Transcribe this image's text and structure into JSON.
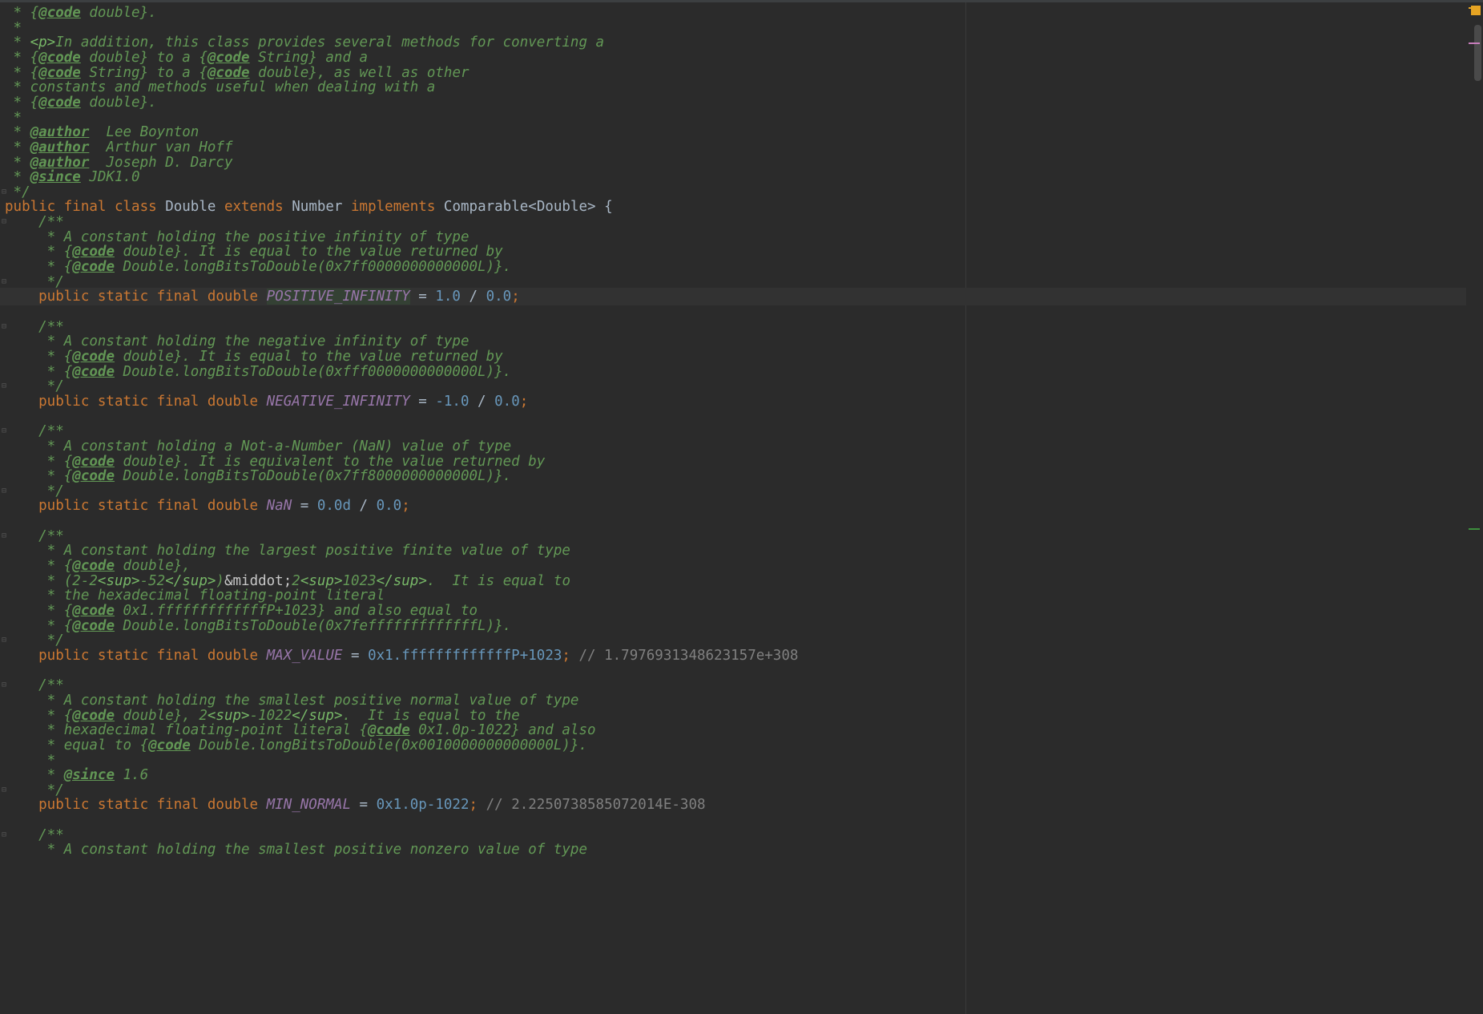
{
  "editor": {
    "language": "java",
    "file_class": "Double",
    "colors": {
      "background": "#2b2b2b",
      "doc_comment": "#629755",
      "keyword": "#cc7832",
      "static_field": "#9876aa",
      "number": "#6897bb",
      "identifier": "#a9b7c6",
      "line_comment": "#808080",
      "caret_line": "#323232"
    },
    "lines": [
      {
        "tokens": [
          {
            "c": "tok-doc",
            "t": " * {"
          },
          {
            "c": "tok-doctag",
            "t": "@code"
          },
          {
            "c": "tok-doc",
            "t": " double}."
          }
        ]
      },
      {
        "tokens": [
          {
            "c": "tok-doc",
            "t": " *"
          }
        ]
      },
      {
        "tokens": [
          {
            "c": "tok-doc",
            "t": " * "
          },
          {
            "c": "tok-dochtml",
            "t": "<p>"
          },
          {
            "c": "tok-doc",
            "t": "In addition, this class provides several methods for converting a"
          }
        ]
      },
      {
        "tokens": [
          {
            "c": "tok-doc",
            "t": " * {"
          },
          {
            "c": "tok-doctag",
            "t": "@code"
          },
          {
            "c": "tok-doc",
            "t": " double} to a {"
          },
          {
            "c": "tok-doctag",
            "t": "@code"
          },
          {
            "c": "tok-doc",
            "t": " String} and a"
          }
        ]
      },
      {
        "tokens": [
          {
            "c": "tok-doc",
            "t": " * {"
          },
          {
            "c": "tok-doctag",
            "t": "@code"
          },
          {
            "c": "tok-doc",
            "t": " String} to a {"
          },
          {
            "c": "tok-doctag",
            "t": "@code"
          },
          {
            "c": "tok-doc",
            "t": " double}, as well as other"
          }
        ]
      },
      {
        "tokens": [
          {
            "c": "tok-doc",
            "t": " * constants and methods useful when dealing with a"
          }
        ]
      },
      {
        "tokens": [
          {
            "c": "tok-doc",
            "t": " * {"
          },
          {
            "c": "tok-doctag",
            "t": "@code"
          },
          {
            "c": "tok-doc",
            "t": " double}."
          }
        ]
      },
      {
        "tokens": [
          {
            "c": "tok-doc",
            "t": " *"
          }
        ]
      },
      {
        "tokens": [
          {
            "c": "tok-doc",
            "t": " * "
          },
          {
            "c": "tok-doctag",
            "t": "@author"
          },
          {
            "c": "tok-doc",
            "t": "  Lee Boynton"
          }
        ]
      },
      {
        "tokens": [
          {
            "c": "tok-doc",
            "t": " * "
          },
          {
            "c": "tok-doctag",
            "t": "@author"
          },
          {
            "c": "tok-doc",
            "t": "  Arthur van Hoff"
          }
        ]
      },
      {
        "tokens": [
          {
            "c": "tok-doc",
            "t": " * "
          },
          {
            "c": "tok-doctag",
            "t": "@author"
          },
          {
            "c": "tok-doc",
            "t": "  Joseph D. Darcy"
          }
        ]
      },
      {
        "tokens": [
          {
            "c": "tok-doc",
            "t": " * "
          },
          {
            "c": "tok-doctag",
            "t": "@since"
          },
          {
            "c": "tok-doc",
            "t": " JDK1.0"
          }
        ]
      },
      {
        "fold": true,
        "tokens": [
          {
            "c": "tok-doc",
            "t": " */"
          }
        ]
      },
      {
        "tokens": [
          {
            "c": "tok-kw",
            "t": "public final class "
          },
          {
            "c": "tok-id",
            "t": "Double "
          },
          {
            "c": "tok-kw",
            "t": "extends "
          },
          {
            "c": "tok-id",
            "t": "Number "
          },
          {
            "c": "tok-kw",
            "t": "implements "
          },
          {
            "c": "tok-id",
            "t": "Comparable<Double> {"
          }
        ]
      },
      {
        "fold": true,
        "tokens": [
          {
            "c": "tok-doc",
            "t": "    /**"
          }
        ]
      },
      {
        "tokens": [
          {
            "c": "tok-doc",
            "t": "     * A constant holding the positive infinity of type"
          }
        ]
      },
      {
        "tokens": [
          {
            "c": "tok-doc",
            "t": "     * {"
          },
          {
            "c": "tok-doctag",
            "t": "@code"
          },
          {
            "c": "tok-doc",
            "t": " double}. It is equal to the value returned by"
          }
        ]
      },
      {
        "tokens": [
          {
            "c": "tok-doc",
            "t": "     * {"
          },
          {
            "c": "tok-doctag",
            "t": "@code"
          },
          {
            "c": "tok-doc",
            "t": " Double.longBitsToDouble(0x7ff0000000000000L)}."
          }
        ]
      },
      {
        "fold": true,
        "tokens": [
          {
            "c": "tok-doc",
            "t": "     */"
          }
        ]
      },
      {
        "caret": true,
        "tokens": [
          {
            "c": "tok-kw",
            "t": "    public static final double "
          },
          {
            "c": "tok-field tok-highlight",
            "t": "POSITIVE_INFINITY"
          },
          {
            "c": "tok-id",
            "t": " = "
          },
          {
            "c": "tok-num",
            "t": "1.0"
          },
          {
            "c": "tok-id",
            "t": " / "
          },
          {
            "c": "tok-num",
            "t": "0.0"
          },
          {
            "c": "tok-punct",
            "t": ";"
          }
        ]
      },
      {
        "tokens": [
          {
            "c": "tok-id",
            "t": ""
          }
        ]
      },
      {
        "fold": true,
        "tokens": [
          {
            "c": "tok-doc",
            "t": "    /**"
          }
        ]
      },
      {
        "tokens": [
          {
            "c": "tok-doc",
            "t": "     * A constant holding the negative infinity of type"
          }
        ]
      },
      {
        "tokens": [
          {
            "c": "tok-doc",
            "t": "     * {"
          },
          {
            "c": "tok-doctag",
            "t": "@code"
          },
          {
            "c": "tok-doc",
            "t": " double}. It is equal to the value returned by"
          }
        ]
      },
      {
        "tokens": [
          {
            "c": "tok-doc",
            "t": "     * {"
          },
          {
            "c": "tok-doctag",
            "t": "@code"
          },
          {
            "c": "tok-doc",
            "t": " Double.longBitsToDouble(0xfff0000000000000L)}."
          }
        ]
      },
      {
        "fold": true,
        "tokens": [
          {
            "c": "tok-doc",
            "t": "     */"
          }
        ]
      },
      {
        "tokens": [
          {
            "c": "tok-kw",
            "t": "    public static final double "
          },
          {
            "c": "tok-field",
            "t": "NEGATIVE_INFINITY"
          },
          {
            "c": "tok-id",
            "t": " = "
          },
          {
            "c": "tok-num",
            "t": "-1.0"
          },
          {
            "c": "tok-id",
            "t": " / "
          },
          {
            "c": "tok-num",
            "t": "0.0"
          },
          {
            "c": "tok-punct",
            "t": ";"
          }
        ]
      },
      {
        "tokens": [
          {
            "c": "tok-id",
            "t": ""
          }
        ]
      },
      {
        "fold": true,
        "tokens": [
          {
            "c": "tok-doc",
            "t": "    /**"
          }
        ]
      },
      {
        "tokens": [
          {
            "c": "tok-doc",
            "t": "     * A constant holding a Not-a-Number (NaN) value of type"
          }
        ]
      },
      {
        "tokens": [
          {
            "c": "tok-doc",
            "t": "     * {"
          },
          {
            "c": "tok-doctag",
            "t": "@code"
          },
          {
            "c": "tok-doc",
            "t": " double}. It is equivalent to the value returned by"
          }
        ]
      },
      {
        "tokens": [
          {
            "c": "tok-doc",
            "t": "     * {"
          },
          {
            "c": "tok-doctag",
            "t": "@code"
          },
          {
            "c": "tok-doc",
            "t": " Double.longBitsToDouble(0x7ff8000000000000L)}."
          }
        ]
      },
      {
        "fold": true,
        "tokens": [
          {
            "c": "tok-doc",
            "t": "     */"
          }
        ]
      },
      {
        "tokens": [
          {
            "c": "tok-kw",
            "t": "    public static final double "
          },
          {
            "c": "tok-field",
            "t": "NaN"
          },
          {
            "c": "tok-id",
            "t": " = "
          },
          {
            "c": "tok-num",
            "t": "0.0d"
          },
          {
            "c": "tok-id",
            "t": " / "
          },
          {
            "c": "tok-num",
            "t": "0.0"
          },
          {
            "c": "tok-punct",
            "t": ";"
          }
        ]
      },
      {
        "tokens": [
          {
            "c": "tok-id",
            "t": ""
          }
        ]
      },
      {
        "fold": true,
        "tokens": [
          {
            "c": "tok-doc",
            "t": "    /**"
          }
        ]
      },
      {
        "tokens": [
          {
            "c": "tok-doc",
            "t": "     * A constant holding the largest positive finite value of type"
          }
        ]
      },
      {
        "tokens": [
          {
            "c": "tok-doc",
            "t": "     * {"
          },
          {
            "c": "tok-doctag",
            "t": "@code"
          },
          {
            "c": "tok-doc",
            "t": " double},"
          }
        ]
      },
      {
        "tokens": [
          {
            "c": "tok-doc",
            "t": "     * (2-2"
          },
          {
            "c": "tok-dochtml",
            "t": "<sup>"
          },
          {
            "c": "tok-doc",
            "t": "-52"
          },
          {
            "c": "tok-dochtml",
            "t": "</sup>"
          },
          {
            "c": "tok-doc",
            "t": ")"
          },
          {
            "c": "tok-dochtml-ent",
            "t": "&middot;"
          },
          {
            "c": "tok-doc",
            "t": "2"
          },
          {
            "c": "tok-dochtml",
            "t": "<sup>"
          },
          {
            "c": "tok-doc",
            "t": "1023"
          },
          {
            "c": "tok-dochtml",
            "t": "</sup>"
          },
          {
            "c": "tok-doc",
            "t": ".  It is equal to"
          }
        ]
      },
      {
        "tokens": [
          {
            "c": "tok-doc",
            "t": "     * the hexadecimal floating-point literal"
          }
        ]
      },
      {
        "tokens": [
          {
            "c": "tok-doc",
            "t": "     * {"
          },
          {
            "c": "tok-doctag",
            "t": "@code"
          },
          {
            "c": "tok-doc",
            "t": " 0x1.fffffffffffffP+1023} and also equal to"
          }
        ]
      },
      {
        "tokens": [
          {
            "c": "tok-doc",
            "t": "     * {"
          },
          {
            "c": "tok-doctag",
            "t": "@code"
          },
          {
            "c": "tok-doc",
            "t": " Double.longBitsToDouble(0x7fefffffffffffffL)}."
          }
        ]
      },
      {
        "fold": true,
        "tokens": [
          {
            "c": "tok-doc",
            "t": "     */"
          }
        ]
      },
      {
        "tokens": [
          {
            "c": "tok-kw",
            "t": "    public static final double "
          },
          {
            "c": "tok-field",
            "t": "MAX_VALUE"
          },
          {
            "c": "tok-id",
            "t": " = "
          },
          {
            "c": "tok-num",
            "t": "0x1.fffffffffffffP+1023"
          },
          {
            "c": "tok-punct",
            "t": ";"
          },
          {
            "c": "tok-comment",
            "t": " // 1.7976931348623157e+308"
          }
        ]
      },
      {
        "tokens": [
          {
            "c": "tok-id",
            "t": ""
          }
        ]
      },
      {
        "fold": true,
        "tokens": [
          {
            "c": "tok-doc",
            "t": "    /**"
          }
        ]
      },
      {
        "tokens": [
          {
            "c": "tok-doc",
            "t": "     * A constant holding the smallest positive normal value of type"
          }
        ]
      },
      {
        "tokens": [
          {
            "c": "tok-doc",
            "t": "     * {"
          },
          {
            "c": "tok-doctag",
            "t": "@code"
          },
          {
            "c": "tok-doc",
            "t": " double}, 2"
          },
          {
            "c": "tok-dochtml",
            "t": "<sup>"
          },
          {
            "c": "tok-doc",
            "t": "-1022"
          },
          {
            "c": "tok-dochtml",
            "t": "</sup>"
          },
          {
            "c": "tok-doc",
            "t": ".  It is equal to the"
          }
        ]
      },
      {
        "tokens": [
          {
            "c": "tok-doc",
            "t": "     * hexadecimal floating-point literal {"
          },
          {
            "c": "tok-doctag",
            "t": "@code"
          },
          {
            "c": "tok-doc",
            "t": " 0x1.0p-1022} and also"
          }
        ]
      },
      {
        "tokens": [
          {
            "c": "tok-doc",
            "t": "     * equal to {"
          },
          {
            "c": "tok-doctag",
            "t": "@code"
          },
          {
            "c": "tok-doc",
            "t": " Double.longBitsToDouble(0x0010000000000000L)}."
          }
        ]
      },
      {
        "tokens": [
          {
            "c": "tok-doc",
            "t": "     *"
          }
        ]
      },
      {
        "tokens": [
          {
            "c": "tok-doc",
            "t": "     * "
          },
          {
            "c": "tok-doctag",
            "t": "@since"
          },
          {
            "c": "tok-doc",
            "t": " 1.6"
          }
        ]
      },
      {
        "fold": true,
        "tokens": [
          {
            "c": "tok-doc",
            "t": "     */"
          }
        ]
      },
      {
        "tokens": [
          {
            "c": "tok-kw",
            "t": "    public static final double "
          },
          {
            "c": "tok-field",
            "t": "MIN_NORMAL"
          },
          {
            "c": "tok-id",
            "t": " = "
          },
          {
            "c": "tok-num",
            "t": "0x1.0p-1022"
          },
          {
            "c": "tok-punct",
            "t": ";"
          },
          {
            "c": "tok-comment",
            "t": " // 2.2250738585072014E-308"
          }
        ]
      },
      {
        "tokens": [
          {
            "c": "tok-id",
            "t": ""
          }
        ]
      },
      {
        "fold": true,
        "tokens": [
          {
            "c": "tok-doc",
            "t": "    /**"
          }
        ]
      },
      {
        "tokens": [
          {
            "c": "tok-doc",
            "t": "     * A constant holding the smallest positive nonzero value of type"
          }
        ]
      }
    ]
  },
  "scrollbar": {
    "markers": [
      {
        "color": "#e6a423",
        "kind": "warning"
      },
      {
        "color": "#c77dbb",
        "kind": "todo"
      },
      {
        "color": "#3d8f3d",
        "kind": "change"
      }
    ]
  }
}
